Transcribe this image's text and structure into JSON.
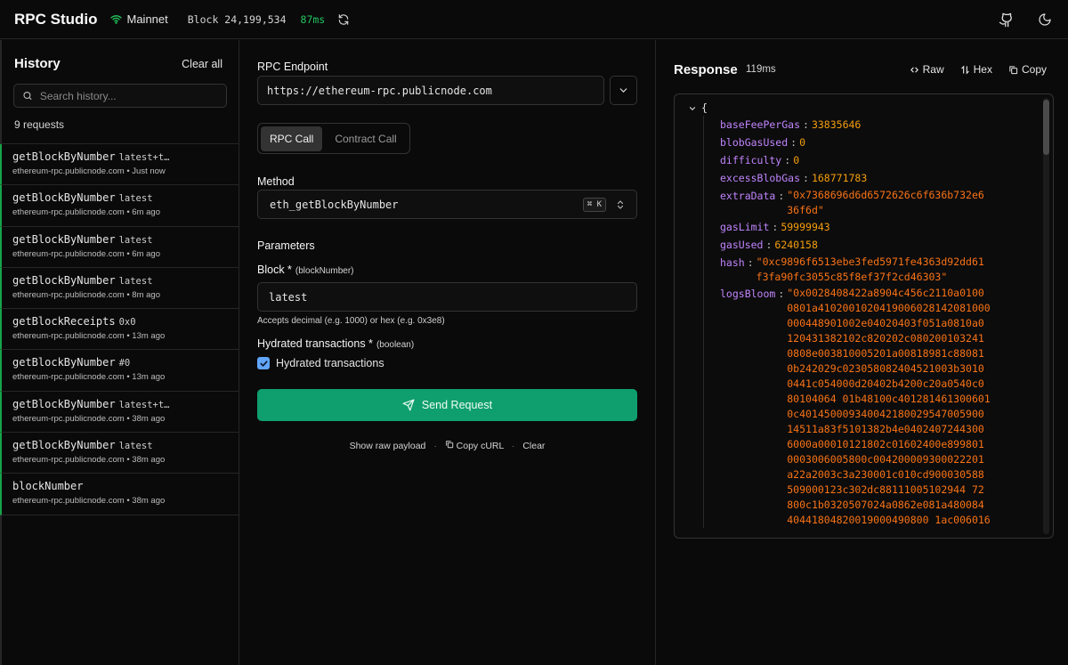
{
  "header": {
    "brand": "RPC Studio",
    "network": "Mainnet",
    "block": "Block 24,199,534",
    "latency": "87ms",
    "icons": [
      "wifi-icon",
      "refresh-icon",
      "github-icon",
      "moon-icon"
    ]
  },
  "history": {
    "title": "History",
    "clear_label": "Clear all",
    "search_placeholder": "Search history...",
    "count": "9 requests",
    "items": [
      {
        "method": "getBlockByNumber",
        "params": "latest+t…",
        "host": "ethereum-rpc.publicnode.com",
        "time": "Just now"
      },
      {
        "method": "getBlockByNumber",
        "params": "latest",
        "host": "ethereum-rpc.publicnode.com",
        "time": "6m ago"
      },
      {
        "method": "getBlockByNumber",
        "params": "latest",
        "host": "ethereum-rpc.publicnode.com",
        "time": "6m ago"
      },
      {
        "method": "getBlockByNumber",
        "params": "latest",
        "host": "ethereum-rpc.publicnode.com",
        "time": "8m ago"
      },
      {
        "method": "getBlockReceipts",
        "params": "0x0",
        "host": "ethereum-rpc.publicnode.com",
        "time": "13m ago"
      },
      {
        "method": "getBlockByNumber",
        "params": "#0",
        "host": "ethereum-rpc.publicnode.com",
        "time": "13m ago"
      },
      {
        "method": "getBlockByNumber",
        "params": "latest+t…",
        "host": "ethereum-rpc.publicnode.com",
        "time": "38m ago"
      },
      {
        "method": "getBlockByNumber",
        "params": "latest",
        "host": "ethereum-rpc.publicnode.com",
        "time": "38m ago"
      },
      {
        "method": "blockNumber",
        "params": "",
        "host": "ethereum-rpc.publicnode.com",
        "time": "38m ago"
      }
    ]
  },
  "request": {
    "endpoint_label": "RPC Endpoint",
    "endpoint_value": "https://ethereum-rpc.publicnode.com",
    "tab_rpc": "RPC Call",
    "tab_contract": "Contract Call",
    "method_label": "Method",
    "method_value": "eth_getBlockByNumber",
    "method_shortcut": "⌘ K",
    "params_label": "Parameters",
    "block_label": "Block *",
    "block_hint": "(blockNumber)",
    "block_value": "latest",
    "block_help": "Accepts decimal (e.g. 1000) or hex (e.g. 0x3e8)",
    "hydrated_label": "Hydrated transactions *",
    "hydrated_hint": "(boolean)",
    "hydrated_checkbox_label": "Hydrated transactions",
    "hydrated_checked": true,
    "send_label": "Send Request",
    "show_raw": "Show raw payload",
    "copy_curl": "Copy cURL",
    "clear": "Clear",
    "separator": "·"
  },
  "response": {
    "title": "Response",
    "time": "119ms",
    "raw_label": "Raw",
    "hex_label": "Hex",
    "copy_label": "Copy",
    "open_brace": "{",
    "fields": [
      {
        "key": "baseFeePerGas",
        "value": "33835646",
        "type": "num"
      },
      {
        "key": "blobGasUsed",
        "value": "0",
        "type": "num"
      },
      {
        "key": "difficulty",
        "value": "0",
        "type": "num"
      },
      {
        "key": "excessBlobGas",
        "value": "168771783",
        "type": "num"
      },
      {
        "key": "extraData",
        "value": "\"0x7368696d6d6572626c6f636b732e6\n36f6d\"",
        "type": "str"
      },
      {
        "key": "gasLimit",
        "value": "59999943",
        "type": "num"
      },
      {
        "key": "gasUsed",
        "value": "6240158",
        "type": "num"
      },
      {
        "key": "hash",
        "value": "\"0xc9896f6513ebe3fed5971fe4363d92dd61\nf3fa90fc3055c85f8ef37f2cd46303\"",
        "type": "str"
      },
      {
        "key": "logsBloom",
        "value": "\"0x0028408422a8904c456c2110a0100\n0801a4102001020419006028142081000\n000448901002e04020403f051a0810a0\n120431382102c820202c080200103241\n0808e003810005201a00818981c88081\n0b242029c023058082404521003b3010\n0441c054000d20402b4200c20a0540c0\n80104064 01b48100c401281461300601\n0c401450009340042180029547005900\n14511a83f5101382b4e0402407244300\n6000a00010121802c01602400e899801\n0003006005800c004200009300022201\na22a2003c3a230001c010cd900030588\n509000123c302dc88111005102944 72\n800c1b0320507024a0862e081a480084\n40441804820019000490800 1ac006016",
        "type": "str"
      }
    ]
  }
}
